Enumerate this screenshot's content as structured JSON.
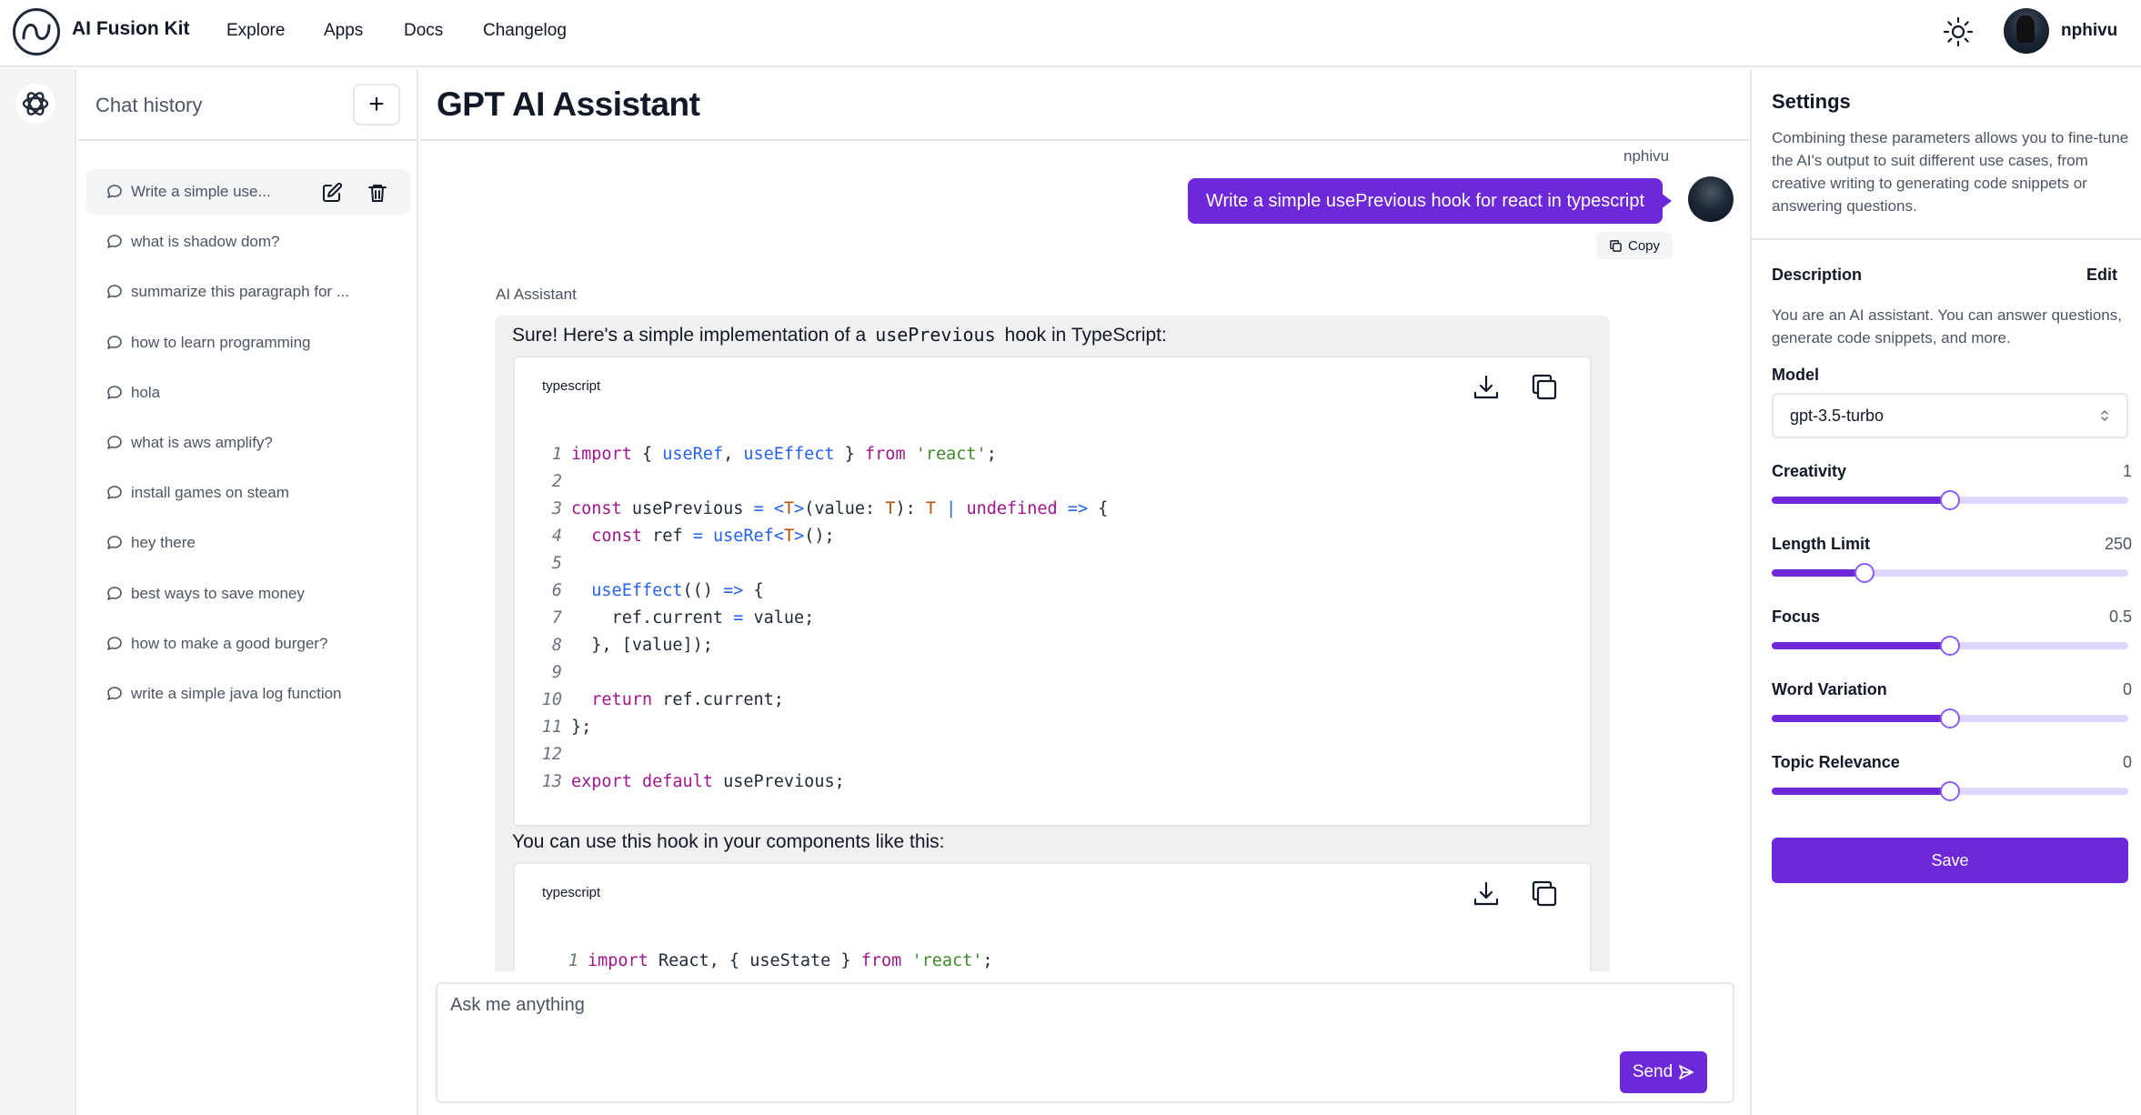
{
  "brand": {
    "name": "AI Fusion Kit",
    "logo_icon": "ai-fusion-logo-icon"
  },
  "nav": {
    "links": [
      "Explore",
      "Apps",
      "Docs",
      "Changelog"
    ]
  },
  "header": {
    "theme_icon": "sun-icon",
    "username": "nphivu"
  },
  "history": {
    "title": "Chat history",
    "new_label": "+",
    "items": [
      "Write a simple use...",
      "what is shadow dom?",
      "summarize this paragraph for ...",
      "how to learn programming",
      "hola",
      "what is aws amplify?",
      "install games on steam",
      "hey there",
      "best ways to save money",
      "how to make a good burger?",
      "write a simple java log function"
    ]
  },
  "chat": {
    "title": "GPT AI Assistant",
    "user_name": "nphivu",
    "user_message": "Write a simple usePrevious hook for react in typescript",
    "copy_label": "Copy",
    "assistant_name": "AI Assistant",
    "intro_before": "Sure! Here's a simple implementation of a",
    "intro_code": "usePrevious",
    "intro_after": "hook in TypeScript:",
    "code1_lang": "typescript",
    "code1_lines": [
      "import { useRef, useEffect } from 'react';",
      "",
      "const usePrevious = <T>(value: T): T | undefined => {",
      "  const ref = useRef<T>();",
      "",
      "  useEffect(() => {",
      "    ref.current = value;",
      "  }, [value]);",
      "",
      "  return ref.current;",
      "};",
      "",
      "export default usePrevious;"
    ],
    "para2": "You can use this hook in your components like this:",
    "code2_lang": "typescript",
    "code2_lines": [
      "import React, { useState } from 'react';"
    ],
    "input_placeholder": "Ask me anything",
    "send_label": "Send"
  },
  "settings": {
    "title": "Settings",
    "intro": "Combining these parameters allows you to fine-tune the AI's output to suit different use cases, from creative writing to generating code snippets or answering questions.",
    "description_label": "Description",
    "edit_label": "Edit",
    "description": "You are an AI assistant. You can answer questions, generate code snippets, and more.",
    "model_label": "Model",
    "model_value": "gpt-3.5-turbo",
    "sliders": [
      {
        "label": "Creativity",
        "value": "1",
        "fraction": 0.5
      },
      {
        "label": "Length Limit",
        "value": "250",
        "fraction": 0.26
      },
      {
        "label": "Focus",
        "value": "0.5",
        "fraction": 0.5
      },
      {
        "label": "Word Variation",
        "value": "0",
        "fraction": 0.5
      },
      {
        "label": "Topic Relevance",
        "value": "0",
        "fraction": 0.5
      }
    ],
    "save_label": "Save"
  },
  "colors": {
    "accent": "#6d28d9",
    "accent_light": "#ddd6fe",
    "panel": "#f1f1f1"
  }
}
